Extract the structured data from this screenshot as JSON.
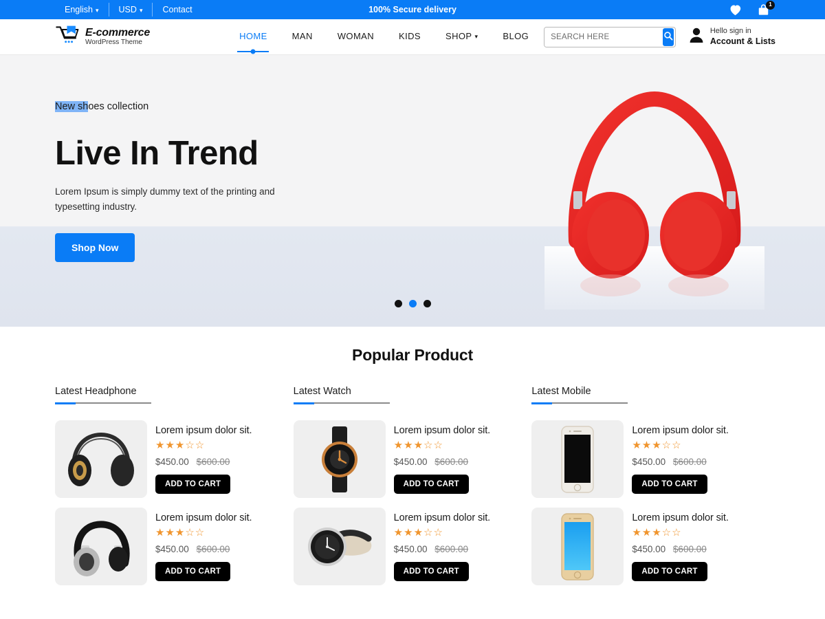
{
  "topbar": {
    "language": "English",
    "currency": "USD",
    "contact": "Contact",
    "promo": "100% Secure delivery",
    "cart_count": "1",
    "accent_color": "#0a7cf6"
  },
  "header": {
    "logo_main": "E-commerce",
    "logo_sub": "WordPress Theme",
    "nav": [
      {
        "label": "HOME",
        "active": true,
        "caret": false
      },
      {
        "label": "MAN",
        "active": false,
        "caret": false
      },
      {
        "label": "WOMAN",
        "active": false,
        "caret": false
      },
      {
        "label": "KIDS",
        "active": false,
        "caret": false
      },
      {
        "label": "SHOP",
        "active": false,
        "caret": true
      },
      {
        "label": "BLOG",
        "active": false,
        "caret": false
      }
    ],
    "search_placeholder": "SEARCH HERE",
    "search_value": "",
    "account_hello": "Hello sign in",
    "account_name": "Account & Lists"
  },
  "hero": {
    "eyebrow_selected": "New sh",
    "eyebrow_rest": "oes collection",
    "title": "Live In Trend",
    "description": "Lorem Ipsum is simply dummy text of the printing and typesetting industry.",
    "button": "Shop Now",
    "dots": [
      {
        "active": false
      },
      {
        "active": true
      },
      {
        "active": false
      }
    ]
  },
  "products": {
    "section_title": "Popular Product",
    "columns": [
      {
        "heading": "Latest Headphone",
        "items": [
          {
            "title": "Lorem ipsum dolor sit.",
            "rating": 3,
            "rating_max": 5,
            "price": "$450.00",
            "price_old": "$600.00",
            "cart_label": "ADD TO CART",
            "image": "headphone-black-gold"
          },
          {
            "title": "Lorem ipsum dolor sit.",
            "rating": 3,
            "rating_max": 5,
            "price": "$450.00",
            "price_old": "$600.00",
            "cart_label": "ADD TO CART",
            "image": "headphone-black-silver"
          }
        ]
      },
      {
        "heading": "Latest Watch",
        "items": [
          {
            "title": "Lorem ipsum dolor sit.",
            "rating": 3,
            "rating_max": 5,
            "price": "$450.00",
            "price_old": "$600.00",
            "cart_label": "ADD TO CART",
            "image": "watch-gold-black"
          },
          {
            "title": "Lorem ipsum dolor sit.",
            "rating": 3,
            "rating_max": 5,
            "price": "$450.00",
            "price_old": "$600.00",
            "cart_label": "ADD TO CART",
            "image": "watch-silver-leather"
          }
        ]
      },
      {
        "heading": "Latest Mobile",
        "items": [
          {
            "title": "Lorem ipsum dolor sit.",
            "rating": 3,
            "rating_max": 5,
            "price": "$450.00",
            "price_old": "$600.00",
            "cart_label": "ADD TO CART",
            "image": "phone-white-off"
          },
          {
            "title": "Lorem ipsum dolor sit.",
            "rating": 3,
            "rating_max": 5,
            "price": "$450.00",
            "price_old": "$600.00",
            "cart_label": "ADD TO CART",
            "image": "phone-gold-blue-screen"
          }
        ]
      }
    ]
  },
  "icons": {
    "heart": "heart-icon",
    "bag": "shopping-bag-icon",
    "user": "user-avatar-icon",
    "search": "search-icon",
    "chevron": "chevron-down-icon",
    "star_filled": "★",
    "star_empty": "☆"
  }
}
